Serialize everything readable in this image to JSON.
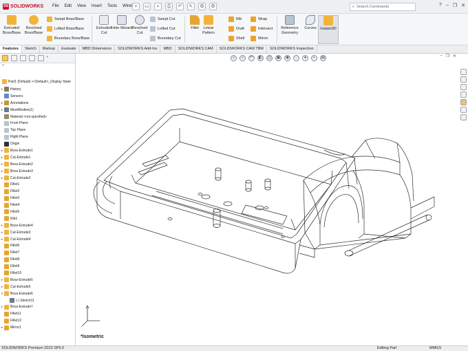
{
  "app": {
    "brand": "SOLIDWORKS",
    "brand_color": "#c8102e"
  },
  "menu": [
    "File",
    "Edit",
    "View",
    "Insert",
    "Tools",
    "Window"
  ],
  "quick_access_icons": [
    "new-icon",
    "open-icon",
    "save-icon",
    "print-icon",
    "undo-icon",
    "select-icon",
    "rebuild-icon",
    "options-icon"
  ],
  "search": {
    "placeholder": "Search Commands"
  },
  "ribbon": {
    "extruded_boss": "Extruded Boss/Base",
    "revolved_boss": "Revolved Boss/Base",
    "swept_boss": "Swept Boss/Base",
    "lofted_boss": "Lofted Boss/Base",
    "boundary_boss": "Boundary Boss/Base",
    "extruded_cut": "Extruded Cut",
    "hole_wizard": "Hole Wizard",
    "revolved_cut": "Revolved Cut",
    "swept_cut": "Swept Cut",
    "lofted_cut": "Lofted Cut",
    "boundary_cut": "Boundary Cut",
    "fillet": "Fillet",
    "linear_pattern": "Linear Pattern",
    "rib": "Rib",
    "draft": "Draft",
    "shell": "Shell",
    "wrap": "Wrap",
    "intersect": "Intersect",
    "mirror": "Mirror",
    "reference_geometry": "Reference Geometry",
    "curves": "Curves",
    "instant3d": "Instant3D"
  },
  "tabs": [
    "Features",
    "Sketch",
    "Markup",
    "Evaluate",
    "MBD Dimensions",
    "SOLIDWORKS Add-Ins",
    "MBD",
    "SOLIDWORKS CAM",
    "SOLIDWORKS CAM TBM",
    "SOLIDWORKS Inspection"
  ],
  "tree": {
    "root": "Part1  (Default) <<Default>_Display State",
    "items": [
      {
        "label": "History",
        "icon": "history-icon",
        "color": "#8a7a5a",
        "arrow": "▸"
      },
      {
        "label": "Sensors",
        "icon": "sensor-icon",
        "color": "#5b8cc8",
        "arrow": ""
      },
      {
        "label": "Annotations",
        "icon": "annotation-icon",
        "color": "#c89a2a",
        "arrow": "▸"
      },
      {
        "label": "MeshBodies(1)",
        "icon": "mesh-icon",
        "color": "#6a7a8a",
        "arrow": "▸"
      },
      {
        "label": "Material <not specified>",
        "icon": "material-icon",
        "color": "#9a8a6a",
        "arrow": ""
      },
      {
        "label": "Front Plane",
        "icon": "plane-icon",
        "color": "#b9c4cf",
        "arrow": ""
      },
      {
        "label": "Top Plane",
        "icon": "plane-icon",
        "color": "#b9c4cf",
        "arrow": ""
      },
      {
        "label": "Right Plane",
        "icon": "plane-icon",
        "color": "#b9c4cf",
        "arrow": ""
      },
      {
        "label": "Origin",
        "icon": "origin-icon",
        "color": "#333333",
        "arrow": ""
      },
      {
        "label": "Boss-Extrude1",
        "icon": "boss-extrude-icon",
        "color": "#f2b33d",
        "arrow": "▸"
      },
      {
        "label": "Cut-Extrude1",
        "icon": "cut-extrude-icon",
        "color": "#f2b33d",
        "arrow": "▸"
      },
      {
        "label": "Boss-Extrude2",
        "icon": "boss-extrude-icon",
        "color": "#f2b33d",
        "arrow": "▸"
      },
      {
        "label": "Boss-Extrude3",
        "icon": "boss-extrude-icon",
        "color": "#f2b33d",
        "arrow": "▸"
      },
      {
        "label": "Cut-Extrude2",
        "icon": "cut-extrude-icon",
        "color": "#f2b33d",
        "arrow": "▸"
      },
      {
        "label": "Fillet1",
        "icon": "fillet-icon",
        "color": "#e7a530",
        "arrow": ""
      },
      {
        "label": "Fillet2",
        "icon": "fillet-icon",
        "color": "#e7a530",
        "arrow": ""
      },
      {
        "label": "Fillet3",
        "icon": "fillet-icon",
        "color": "#e7a530",
        "arrow": ""
      },
      {
        "label": "Fillet4",
        "icon": "fillet-icon",
        "color": "#e7a530",
        "arrow": ""
      },
      {
        "label": "Fillet5",
        "icon": "fillet-icon",
        "color": "#e7a530",
        "arrow": ""
      },
      {
        "label": "Rib1",
        "icon": "rib-icon",
        "color": "#e7a530",
        "arrow": ""
      },
      {
        "label": "Boss-Extrude4",
        "icon": "boss-extrude-icon",
        "color": "#f2b33d",
        "arrow": "▸"
      },
      {
        "label": "Cut-Extrude3",
        "icon": "cut-extrude-icon",
        "color": "#f2b33d",
        "arrow": "▸"
      },
      {
        "label": "Cut-Extrude4",
        "icon": "cut-extrude-icon",
        "color": "#f2b33d",
        "arrow": "▸"
      },
      {
        "label": "Fillet6",
        "icon": "fillet-icon",
        "color": "#e7a530",
        "arrow": ""
      },
      {
        "label": "Fillet7",
        "icon": "fillet-icon",
        "color": "#e7a530",
        "arrow": ""
      },
      {
        "label": "Fillet8",
        "icon": "fillet-icon",
        "color": "#e7a530",
        "arrow": ""
      },
      {
        "label": "Fillet9",
        "icon": "fillet-icon",
        "color": "#e7a530",
        "arrow": ""
      },
      {
        "label": "Fillet10",
        "icon": "fillet-icon",
        "color": "#e7a530",
        "arrow": ""
      },
      {
        "label": "Boss-Extrude5",
        "icon": "boss-extrude-icon",
        "color": "#f2b33d",
        "arrow": "▸"
      },
      {
        "label": "Cut-Extrude5",
        "icon": "cut-extrude-icon",
        "color": "#f2b33d",
        "arrow": "▸"
      },
      {
        "label": "Boss-Extrude6",
        "icon": "boss-extrude-icon",
        "color": "#f2b33d",
        "arrow": "▾"
      },
      {
        "label": "(-) Sketch11",
        "icon": "sketch-icon",
        "color": "#6b7b8b",
        "arrow": ""
      },
      {
        "label": "Boss-Extrude7",
        "icon": "boss-extrude-icon",
        "color": "#f2b33d",
        "arrow": "▸"
      },
      {
        "label": "Fillet11",
        "icon": "fillet-icon",
        "color": "#e7a530",
        "arrow": ""
      },
      {
        "label": "Fillet12",
        "icon": "fillet-icon",
        "color": "#e7a530",
        "arrow": ""
      },
      {
        "label": "Mirror1",
        "icon": "mirror-icon",
        "color": "#e7a530",
        "arrow": "▸"
      }
    ]
  },
  "viewport": {
    "view_name": "*Isometric"
  },
  "status": {
    "product": "SOLIDWORKS Premium 2023 SP5.0",
    "mode": "Editing Part",
    "units": "MMGS"
  }
}
